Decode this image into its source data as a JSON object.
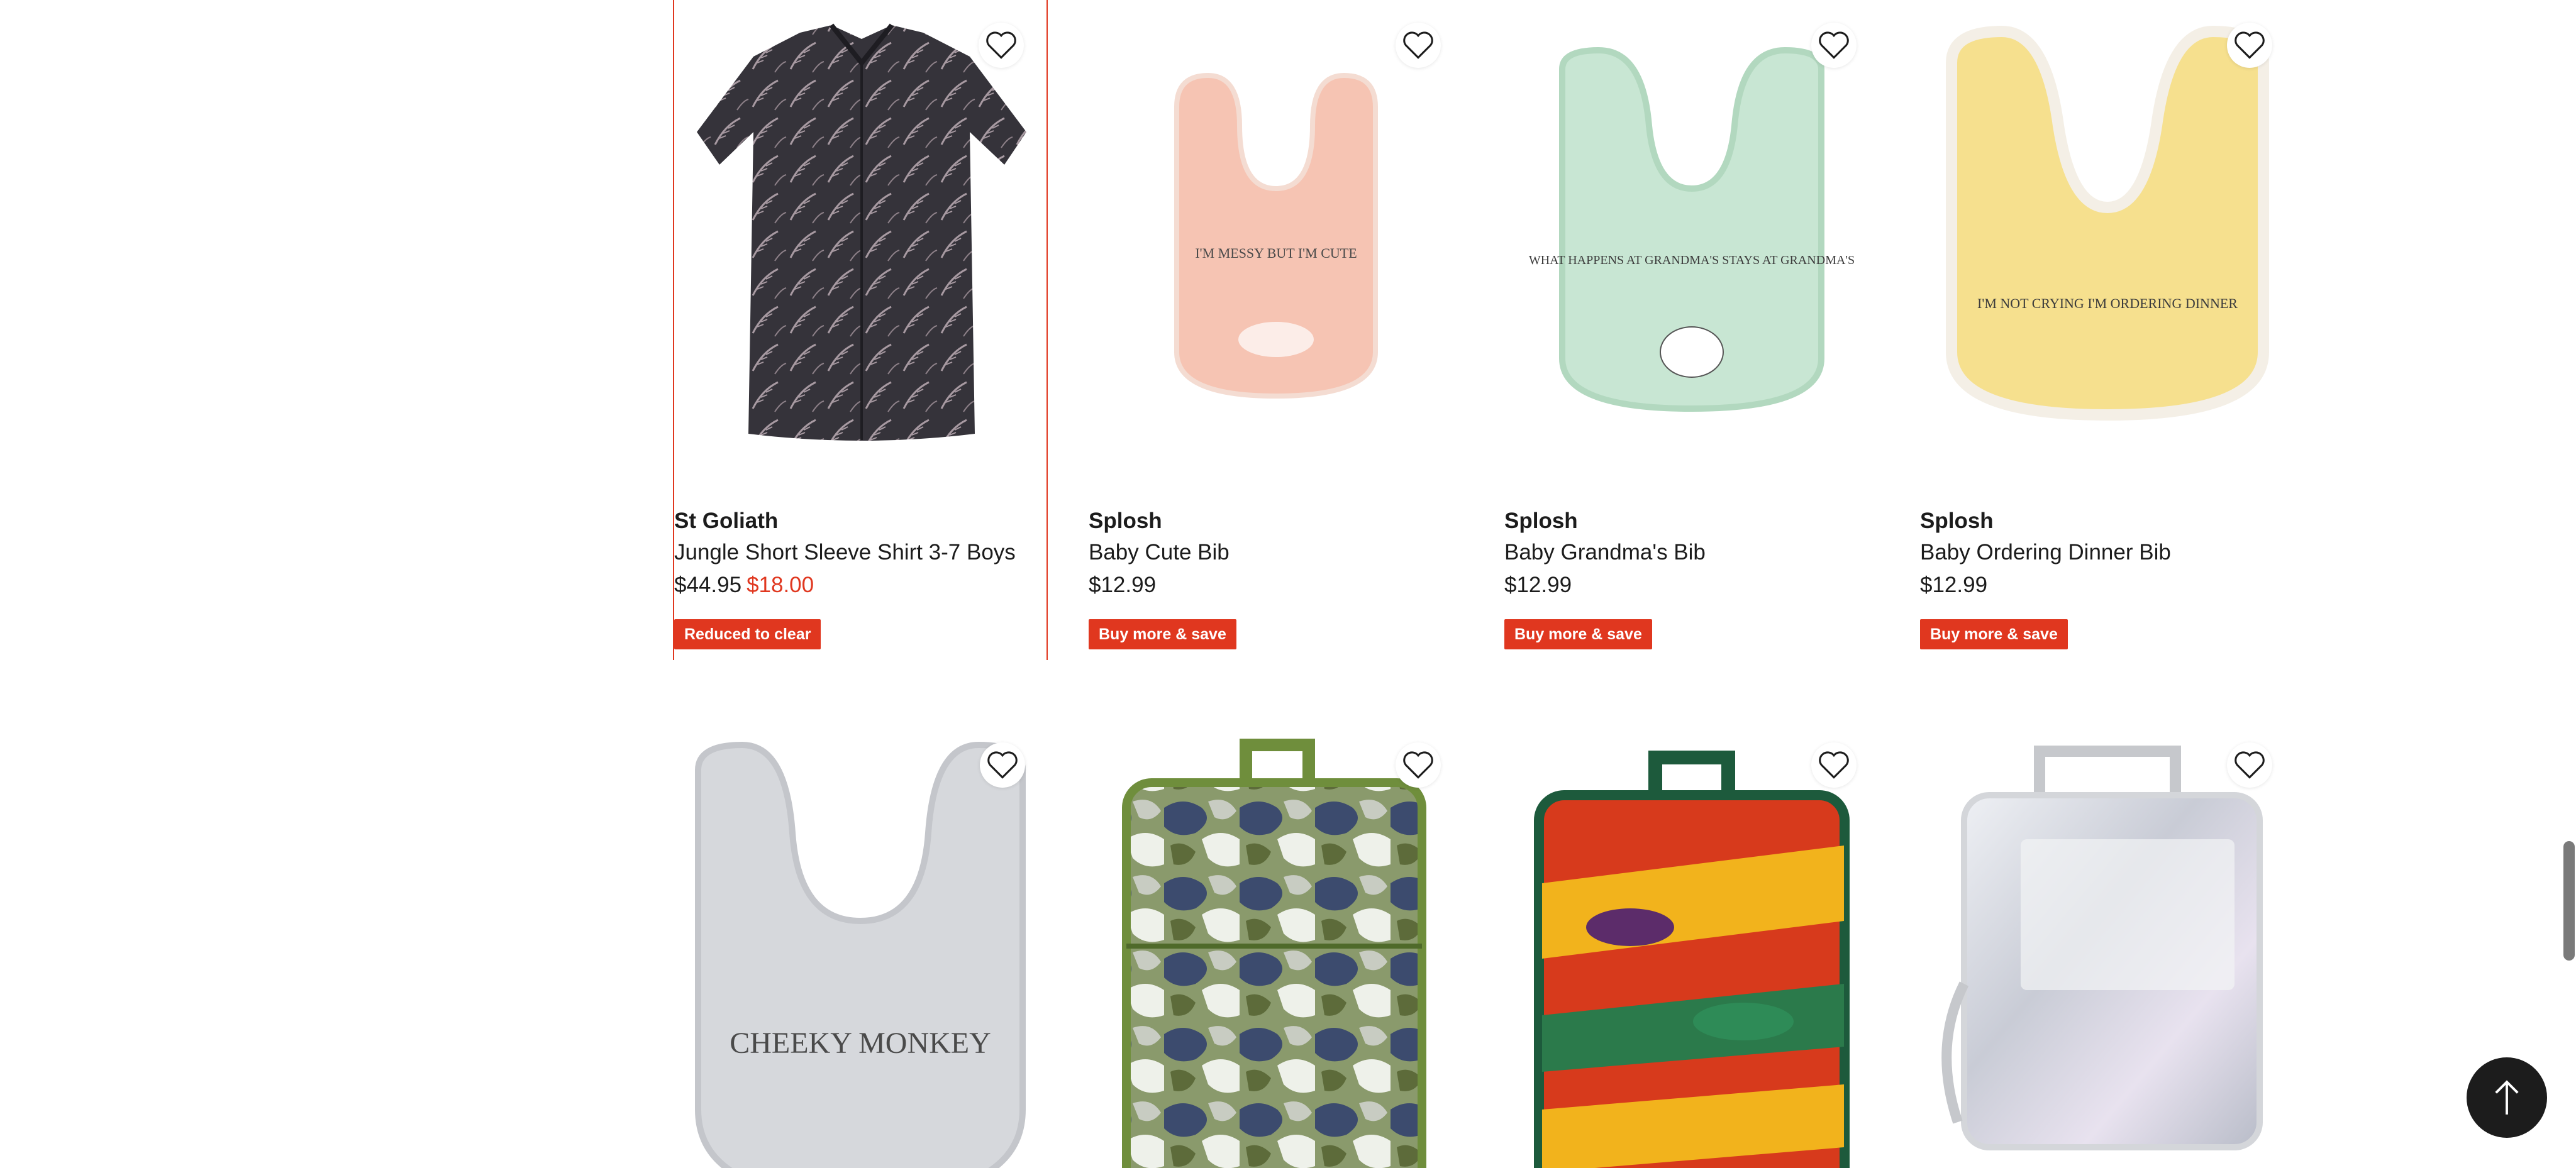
{
  "products_row1": [
    {
      "brand": "St Goliath",
      "title": "Jungle Short Sleeve Shirt 3-7 Boys",
      "price_was": "$44.95",
      "price_now": "$18.00",
      "badge": "Reduced to clear",
      "image": "shirt-image"
    },
    {
      "brand": "Splosh",
      "title": "Baby Cute Bib",
      "price": "$12.99",
      "badge": "Buy more & save",
      "image": "bib-pink-image",
      "bib_text": "I'M MESSY BUT I'M CUTE"
    },
    {
      "brand": "Splosh",
      "title": "Baby Grandma's Bib",
      "price": "$12.99",
      "badge": "Buy more & save",
      "image": "bib-green-image",
      "bib_text": "WHAT HAPPENS AT GRANDMA'S STAYS AT GRANDMA'S"
    },
    {
      "brand": "Splosh",
      "title": "Baby Ordering Dinner Bib",
      "price": "$12.99",
      "badge": "Buy more & save",
      "image": "bib-yellow-image",
      "bib_text": "I'M NOT CRYING I'M ORDERING DINNER"
    }
  ],
  "products_row2": [
    {
      "image": "bib-grey-image",
      "bib_text": "CHEEKY MONKEY"
    },
    {
      "image": "camo-lunchbag-image"
    },
    {
      "image": "dino-lunchbag-image"
    },
    {
      "image": "silver-lunchbag-image"
    }
  ],
  "icons": {
    "wishlist": "heart-outline-icon",
    "back_to_top": "arrow-up-icon"
  },
  "colors": {
    "accent_red": "#e0371f",
    "text": "#1c1c1c",
    "button_dark": "#1c1c1c"
  }
}
